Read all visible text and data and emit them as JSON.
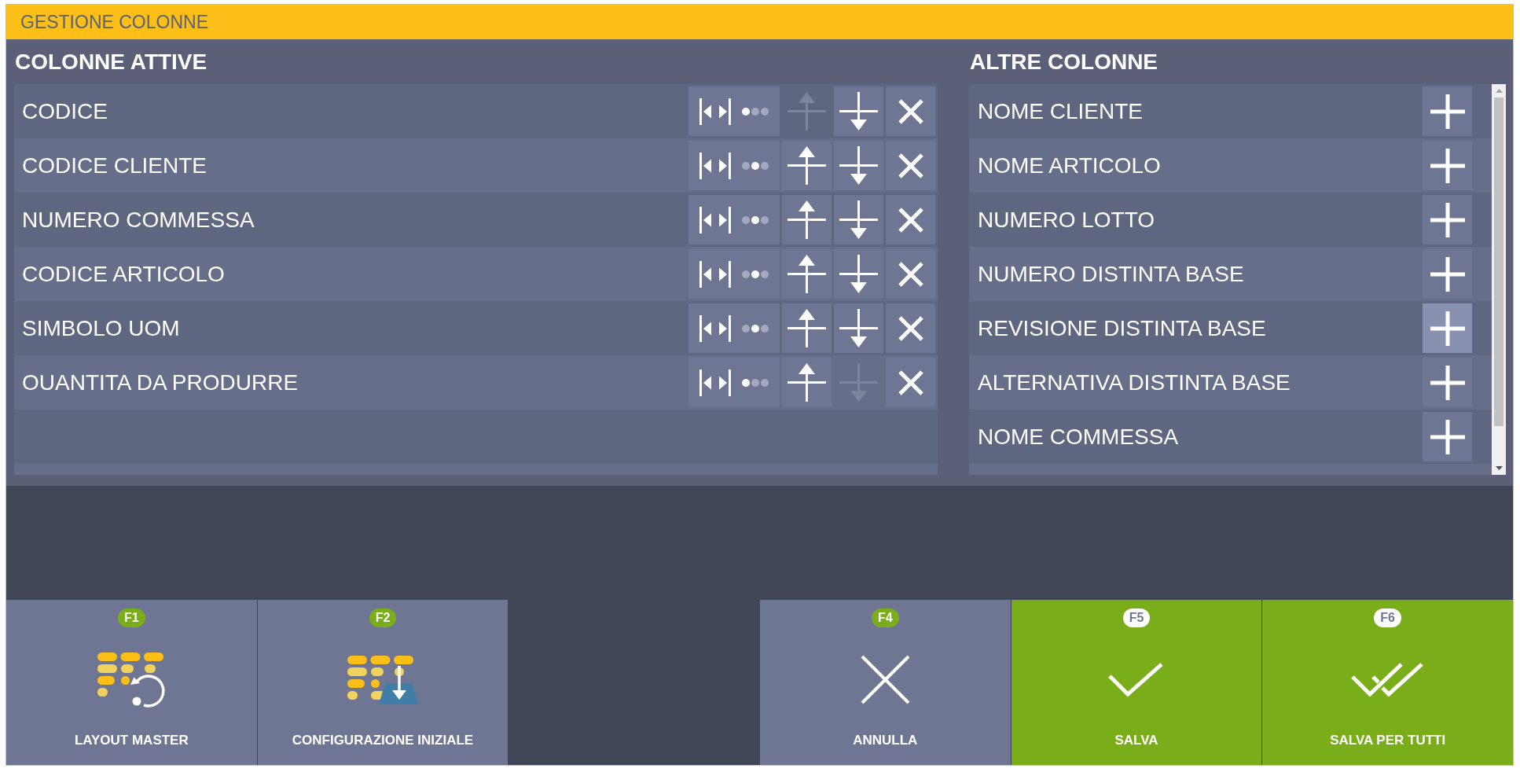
{
  "window": {
    "title": "GESTIONE COLONNE"
  },
  "active_columns": {
    "heading": "COLONNE ATTIVE",
    "items": [
      {
        "label": "CODICE",
        "dots": [
          {
            "selected": true
          },
          {
            "selected": false
          },
          {
            "selected": false
          }
        ],
        "up_disabled": true,
        "down_disabled": false
      },
      {
        "label": "CODICE CLIENTE",
        "dots": [
          {
            "selected": false
          },
          {
            "selected": true
          },
          {
            "selected": false
          }
        ],
        "up_disabled": false,
        "down_disabled": false
      },
      {
        "label": "NUMERO COMMESSA",
        "dots": [
          {
            "selected": false
          },
          {
            "selected": true
          },
          {
            "selected": false
          }
        ],
        "up_disabled": false,
        "down_disabled": false
      },
      {
        "label": "CODICE ARTICOLO",
        "dots": [
          {
            "selected": false
          },
          {
            "selected": true
          },
          {
            "selected": false
          }
        ],
        "up_disabled": false,
        "down_disabled": false
      },
      {
        "label": "SIMBOLO UOM",
        "dots": [
          {
            "selected": false
          },
          {
            "selected": true
          },
          {
            "selected": false
          }
        ],
        "up_disabled": false,
        "down_disabled": false
      },
      {
        "label": "OUANTITA DA PRODURRE",
        "dots": [
          {
            "selected": true
          },
          {
            "selected": false
          },
          {
            "selected": false
          }
        ],
        "up_disabled": false,
        "down_disabled": true
      }
    ]
  },
  "other_columns": {
    "heading": "ALTRE COLONNE",
    "items": [
      {
        "label": "NOME CLIENTE",
        "highlighted": false
      },
      {
        "label": "NOME ARTICOLO",
        "highlighted": false
      },
      {
        "label": "NUMERO LOTTO",
        "highlighted": false
      },
      {
        "label": "NUMERO DISTINTA BASE",
        "highlighted": false
      },
      {
        "label": "REVISIONE DISTINTA BASE",
        "highlighted": true
      },
      {
        "label": "ALTERNATIVA DISTINTA BASE",
        "highlighted": false
      },
      {
        "label": "NOME COMMESSA",
        "highlighted": false
      }
    ]
  },
  "function_keys": {
    "left": [
      {
        "key": "F1",
        "label": "LAYOUT MASTER",
        "kind": "secondary"
      },
      {
        "key": "F2",
        "label": "CONFIGURAZIONE INIZIALE",
        "kind": "secondary"
      }
    ],
    "right": [
      {
        "key": "F4",
        "label": "ANNULLA",
        "kind": "secondary"
      },
      {
        "key": "F5",
        "label": "SALVA",
        "kind": "primary"
      },
      {
        "key": "F6",
        "label": "SALVA PER TUTTI",
        "kind": "primary"
      }
    ]
  }
}
